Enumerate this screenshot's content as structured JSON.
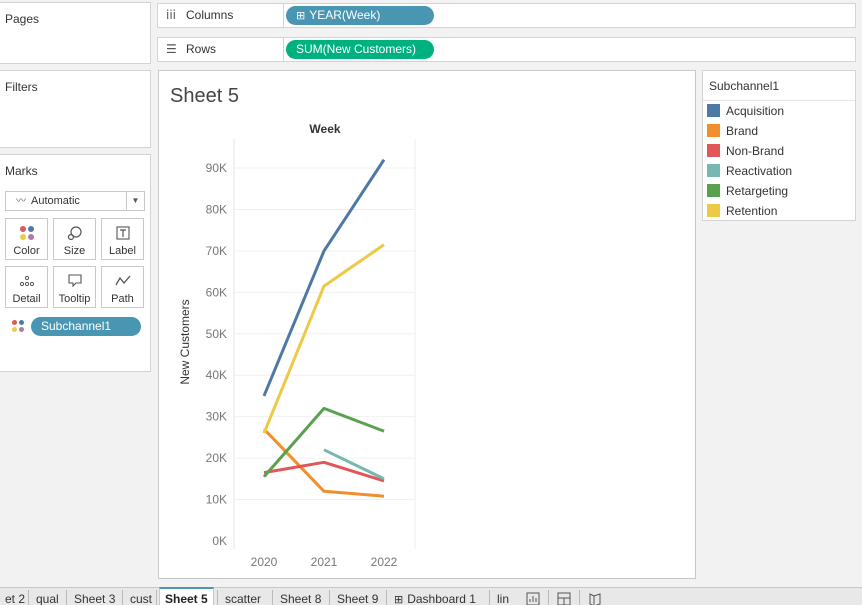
{
  "cards": {
    "pages": "Pages",
    "filters": "Filters",
    "marks": "Marks",
    "mark_type": "Automatic",
    "buttons": {
      "color": "Color",
      "size": "Size",
      "label": "Label",
      "detail": "Detail",
      "tooltip": "Tooltip",
      "path": "Path"
    },
    "color_pill": "Subchannel1"
  },
  "shelves": {
    "columns_label": "Columns",
    "columns_pill": "YEAR(Week)",
    "rows_label": "Rows",
    "rows_pill": "SUM(New Customers)"
  },
  "sheet": {
    "title": "Sheet 5"
  },
  "chart_data": {
    "type": "line",
    "title": "Week",
    "xlabel": "",
    "ylabel": "New Customers",
    "categories": [
      "2020",
      "2021",
      "2022"
    ],
    "ylim": [
      0,
      95000
    ],
    "yticks": [
      0,
      10000,
      20000,
      30000,
      40000,
      50000,
      60000,
      70000,
      80000,
      90000
    ],
    "ytick_labels": [
      "0K",
      "10K",
      "20K",
      "30K",
      "40K",
      "50K",
      "60K",
      "70K",
      "80K",
      "90K"
    ],
    "grid": true,
    "legend_placement": "right",
    "series": [
      {
        "name": "Acquisition",
        "color": "#4e79a7",
        "values": [
          35000,
          70000,
          92000
        ]
      },
      {
        "name": "Brand",
        "color": "#f28e2b",
        "values": [
          27000,
          12000,
          10800
        ]
      },
      {
        "name": "Non-Brand",
        "color": "#e15759",
        "values": [
          16500,
          19000,
          14500
        ]
      },
      {
        "name": "Reactivation",
        "color": "#76b7b2",
        "values": [
          null,
          22000,
          15000
        ]
      },
      {
        "name": "Retargeting",
        "color": "#59a14f",
        "values": [
          15500,
          32000,
          26500
        ]
      },
      {
        "name": "Retention",
        "color": "#edc948",
        "values": [
          26000,
          61500,
          71500
        ]
      }
    ]
  },
  "legend": {
    "title": "Subchannel1",
    "items": [
      "Acquisition",
      "Brand",
      "Non-Brand",
      "Reactivation",
      "Retargeting",
      "Retention"
    ]
  },
  "tabs": [
    {
      "label": "et 2",
      "active": false
    },
    {
      "label": "qual",
      "active": false
    },
    {
      "label": "Sheet 3",
      "active": false
    },
    {
      "label": "cust",
      "active": false
    },
    {
      "label": "Sheet 5",
      "active": true
    },
    {
      "label": "scatter",
      "active": false
    },
    {
      "label": "Sheet 8",
      "active": false
    },
    {
      "label": "Sheet 9",
      "active": false
    },
    {
      "label": "Dashboard 1",
      "active": false
    },
    {
      "label": "lin",
      "active": false
    }
  ]
}
